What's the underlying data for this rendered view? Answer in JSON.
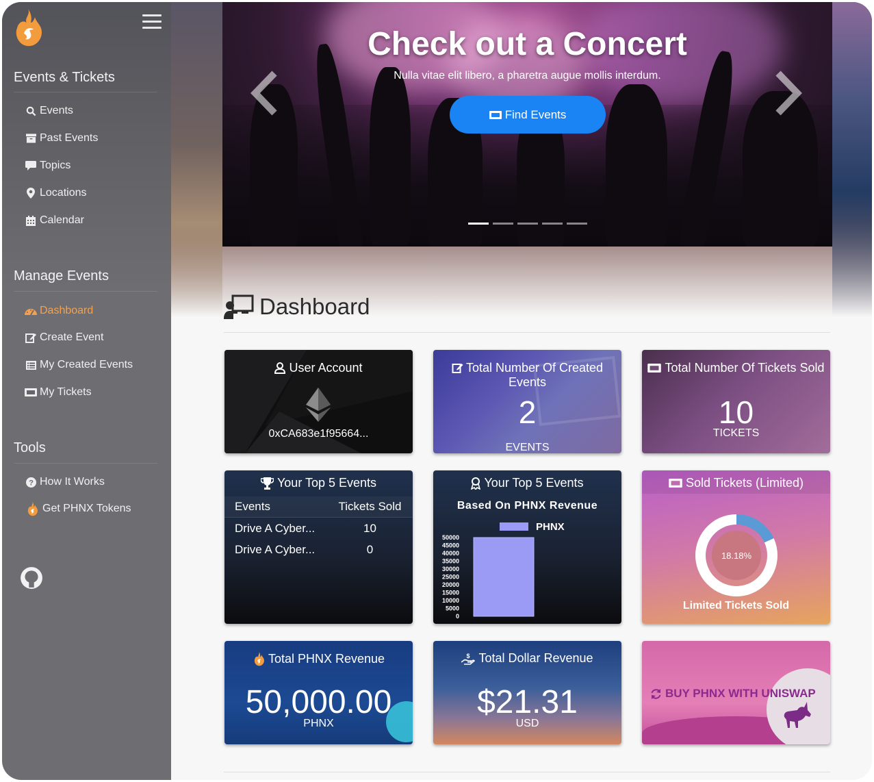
{
  "sidebar": {
    "sections": [
      {
        "title": "Events & Tickets",
        "items": [
          {
            "label": "Events",
            "icon": "search-icon"
          },
          {
            "label": "Past Events",
            "icon": "archive-icon"
          },
          {
            "label": "Topics",
            "icon": "comment-icon"
          },
          {
            "label": "Locations",
            "icon": "map-marker-icon"
          },
          {
            "label": "Calendar",
            "icon": "calendar-icon"
          }
        ]
      },
      {
        "title": "Manage Events",
        "items": [
          {
            "label": "Dashboard",
            "icon": "dashboard-icon",
            "active": true
          },
          {
            "label": "Create Event",
            "icon": "edit-icon"
          },
          {
            "label": "My Created Events",
            "icon": "list-icon"
          },
          {
            "label": "My Tickets",
            "icon": "ticket-icon"
          }
        ]
      },
      {
        "title": "Tools",
        "items": [
          {
            "label": "How It Works",
            "icon": "question-circle-icon"
          },
          {
            "label": "Get PHNX Tokens",
            "icon": "phoenix-icon"
          }
        ]
      }
    ]
  },
  "carousel": {
    "title": "Check out a Concert",
    "subtitle": "Nulla vitae elit libero, a pharetra augue mollis interdum.",
    "button_label": "Find Events",
    "slide_count": 5,
    "active_slide": 1
  },
  "dashboard": {
    "title": "Dashboard",
    "cards": {
      "account": {
        "title": "User Account",
        "address": "0xCA683e1f95664..."
      },
      "created": {
        "title": "Total Number Of Created Events",
        "value": "2",
        "unit": "EVENTS"
      },
      "sold": {
        "title": "Total Number Of Tickets Sold",
        "value": "10",
        "unit": "TICKETS"
      },
      "top5": {
        "title": "Your Top 5 Events",
        "columns": [
          "Events",
          "Tickets Sold"
        ],
        "rows": [
          [
            "Drive A Cyber...",
            "10"
          ],
          [
            "Drive A Cyber...",
            "0"
          ]
        ]
      },
      "top5rev": {
        "title": "Your Top 5 Events",
        "subtitle": "Based On PHNX Revenue"
      },
      "limited": {
        "title": "Sold Tickets (Limited)",
        "percent_label": "18.18%",
        "caption": "Limited Tickets Sold"
      },
      "phnx": {
        "title": "Total PHNX Revenue",
        "value": "50,000.00",
        "unit": "PHNX"
      },
      "usd": {
        "title": "Total Dollar Revenue",
        "value": "$21.31",
        "unit": "USD"
      },
      "uniswap": {
        "label": "BUY PHNX WITH UNISWAP"
      }
    }
  },
  "colors": {
    "accent": "#f6a04d",
    "primary_button": "#1a84f5",
    "sidebar": "#6e6e72"
  },
  "chart_data": {
    "type": "bar",
    "title": "",
    "categories": [
      ""
    ],
    "series": [
      {
        "name": "PHNX",
        "values": [
          50000
        ]
      }
    ],
    "ylim": [
      0,
      50000
    ],
    "yticks": [
      "50000",
      "45000",
      "40000",
      "35000",
      "30000",
      "25000",
      "20000",
      "15000",
      "10000",
      "5000",
      "0"
    ],
    "legend": "top",
    "grid": false
  },
  "donut": {
    "type": "pie",
    "values": [
      18.18,
      81.82
    ],
    "colors": [
      "#5b9bd5",
      "#ffffff"
    ]
  }
}
